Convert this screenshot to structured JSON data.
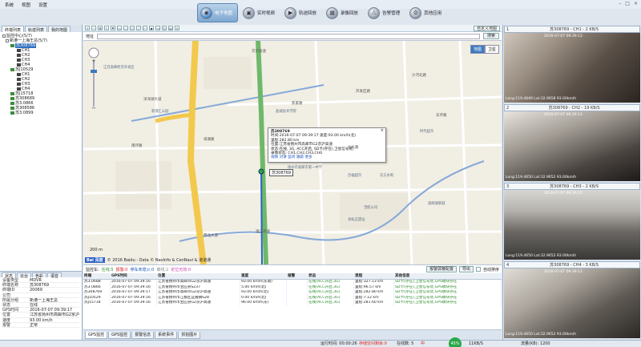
{
  "menu": [
    "系统",
    "视图",
    "设置"
  ],
  "nav": [
    {
      "label": "电子地图",
      "active": true,
      "icon": "globe-icon",
      "glyph": "◉"
    },
    {
      "label": "实时视频",
      "active": false,
      "icon": "camera-icon",
      "glyph": "▣"
    },
    {
      "label": "轨迹回放",
      "active": false,
      "icon": "play-icon",
      "glyph": "▶"
    },
    {
      "label": "录像回放",
      "active": false,
      "icon": "video-icon",
      "glyph": "▦"
    },
    {
      "label": "告警管理",
      "active": false,
      "icon": "alarm-icon",
      "glyph": "⚠"
    },
    {
      "label": "其他应用",
      "active": false,
      "icon": "gear-icon",
      "glyph": "⚙"
    }
  ],
  "window_buttons": [
    "–",
    "□",
    "×"
  ],
  "left_tabs": [
    "终端列表",
    "轨迹列表",
    "我的地图"
  ],
  "tree": [
    {
      "text": "监控中心(5/7)",
      "indent": 0,
      "kind": "box"
    },
    {
      "text": "新港一上海王总(5/7)",
      "indent": 4,
      "kind": "box"
    },
    {
      "text": "苏308769",
      "indent": 10,
      "kind": "veh",
      "sel": true
    },
    {
      "text": "CH1",
      "indent": 18,
      "kind": "cam"
    },
    {
      "text": "CH2",
      "indent": 18,
      "kind": "cam"
    },
    {
      "text": "CH3",
      "indent": 18,
      "kind": "cam"
    },
    {
      "text": "CH4",
      "indent": 18,
      "kind": "cam"
    },
    {
      "text": "苏J10529",
      "indent": 10,
      "kind": "veh"
    },
    {
      "text": "CH1",
      "indent": 18,
      "kind": "cam"
    },
    {
      "text": "CH2",
      "indent": 18,
      "kind": "cam"
    },
    {
      "text": "CH3",
      "indent": 18,
      "kind": "cam"
    },
    {
      "text": "CH4",
      "indent": 18,
      "kind": "cam"
    },
    {
      "text": "苏J15718",
      "indent": 10,
      "kind": "veh"
    },
    {
      "text": "苏308689",
      "indent": 10,
      "kind": "veh"
    },
    {
      "text": "苏3.0866",
      "indent": 10,
      "kind": "veh"
    },
    {
      "text": "苏308586",
      "indent": 10,
      "kind": "veh"
    },
    {
      "text": "苏3.0899",
      "indent": 10,
      "kind": "veh"
    }
  ],
  "status_tabs": [
    "状态",
    "云台",
    "色彩",
    "语音"
  ],
  "status_rows": [
    [
      "设备类型",
      "MDVR"
    ],
    [
      "终端名称",
      "苏308769"
    ],
    [
      "终端ID",
      "20069"
    ],
    [
      "公司",
      ""
    ],
    [
      "所属分组",
      "新港一上海王总"
    ],
    [
      "状态",
      "在线"
    ],
    [
      "GPS时间",
      "2016-07-07 09:39:17"
    ],
    [
      "位置",
      "江苏省扬州市高邮市G2京沪高速"
    ],
    [
      "速度",
      "93.00 km/h"
    ],
    [
      "报警",
      "正常"
    ]
  ],
  "map_toolbar": {
    "custom_view": "自定义地图"
  },
  "address": {
    "label": "地址",
    "search": "搜索"
  },
  "map": {
    "types": [
      "地图",
      "卫星"
    ],
    "popup": {
      "plate": "苏308769",
      "line1": "时间:2016-07-07 09:39:17    速度:93.00 km/h(北)",
      "line2": "里程:282.80 km",
      "line3": "位置:江苏省扬州市高邮市G2京沪高速",
      "line4": "状态:在线, 3G, ACC开启, SD卡(存在),卫星信号优,",
      "line5": "录像状态: CH1,CH2,CH3,CH4",
      "links": "视频  对讲  监听  跟踪  更多"
    },
    "vehicle_label": "苏308769",
    "scale": "200 m",
    "copyright": "© 2016 Baidu - Data © NavInfo & CenNavi & 道道通",
    "roads": [
      "京沪高速",
      "南环路",
      "渌洋湖大道",
      "海潮路",
      "龙虬路",
      "沙河北路",
      "东环路",
      "开发区路",
      "苏北大道",
      "焦家路",
      "淮江高速"
    ],
    "places": [
      "江苏高邮经济开发区",
      "盐城技术学院",
      "时代超市",
      "扬州市高邮市第一中学",
      "新港汇公园",
      "高邮湖新城",
      "东方水利",
      "百福超市",
      "龙虬庄遗址",
      "宝航公司"
    ]
  },
  "legend": {
    "prefix": "监控车:",
    "online": "在线:5",
    "alarm": "报警:0",
    "parked": "停车未熄火:0",
    "offline": "离线:2",
    "invalid": "定位无效:0",
    "btn_alarm": "报警屏蔽配置",
    "btn_export": "导出",
    "autosort": "自动排序"
  },
  "grid": {
    "headers": [
      "终端",
      "GPS时间",
      "位置",
      "速度",
      "报警",
      "状态",
      "里程",
      "其他信息"
    ],
    "rows": [
      [
        "苏3.0688",
        "2016-07-07 09:39:16",
        "江苏省扬州市高邮市G2京沪高速",
        "93.00 km/h(东南)",
        "",
        "在线(ACC开启,3G)",
        "里程:327.13 km",
        "SD卡(存在),卫星信号优,GPS模块存在"
      ],
      [
        "苏3.0866",
        "2016-07-07 09:39:16",
        "江苏省扬州市宝应县S237",
        "5.00 km/h(北)",
        "",
        "在线(ACC开启,3G)",
        "里程:96.57 km",
        "SD卡(存在),卫星信号优,GPS模块存在"
      ],
      [
        "苏308769",
        "2016-07-07 09:39:17",
        "江苏省扬州市高邮市G2京沪高速",
        "93.00 km/h(北)",
        "",
        "在线(ACC开启,3G)",
        "里程:282.80 km",
        "SD卡(存在),卫星信号优,GPS模块存在"
      ],
      [
        "苏J10529",
        "2016-07-07 09:39:16",
        "江苏省扬州市江都区宜陵镇S28",
        "0.00 km/h(北)",
        "",
        "在线(ACC开启,3G)",
        "里程:7.12 km",
        "SD卡(存在),卫星信号优,GPS模块存在"
      ],
      [
        "苏J15718",
        "2016-07-07 09:39:16",
        "江苏省扬州市宝应县G2京沪高速",
        "96.00 km/h(东)",
        "",
        "在线(ACC开启,3G)",
        "里程:281.60 km",
        "SD卡(存在),卫星信号优,GPS模块存在"
      ]
    ]
  },
  "bottom_tabs": [
    "GPS监控",
    "GPS监控",
    "报警信息",
    "系统事件",
    "抓拍图片"
  ],
  "cams": [
    {
      "title": "苏308769 - CH1 - 2 KB/S",
      "num": "1",
      "ts": "2016-07-07 09:39:13",
      "ov": "Long:119.4649  Lat:32.9658  93.00km/h"
    },
    {
      "title": "苏308769 - CH2 - 19 KB/S",
      "num": "2",
      "ts": "2016-07-07 09:39:13",
      "ov": "Long:119.4650  Lat:32.9652  93.00km/h"
    },
    {
      "title": "苏308769 - CH3 - 2 KB/S",
      "num": "3",
      "ts": "2016-07-07 09:39:13",
      "ov": "Long:119.4650  Lat:32.9652  93.00km/h"
    },
    {
      "title": "苏308769 - CH4 - 3 KB/S",
      "num": "4",
      "ts": "2016-07-07 09:39:13",
      "ov": "Long:119.4650  Lat:32.9652  93.00km/h"
    }
  ],
  "statusbar": {
    "runtime": "运行时间: 00:00:26",
    "loss": "存储空间剩余:0",
    "online": "在线数: 5",
    "ime": "中",
    "cpu": "45%",
    "net": "11KB/S",
    "flow": "流量(KB): 1200"
  }
}
